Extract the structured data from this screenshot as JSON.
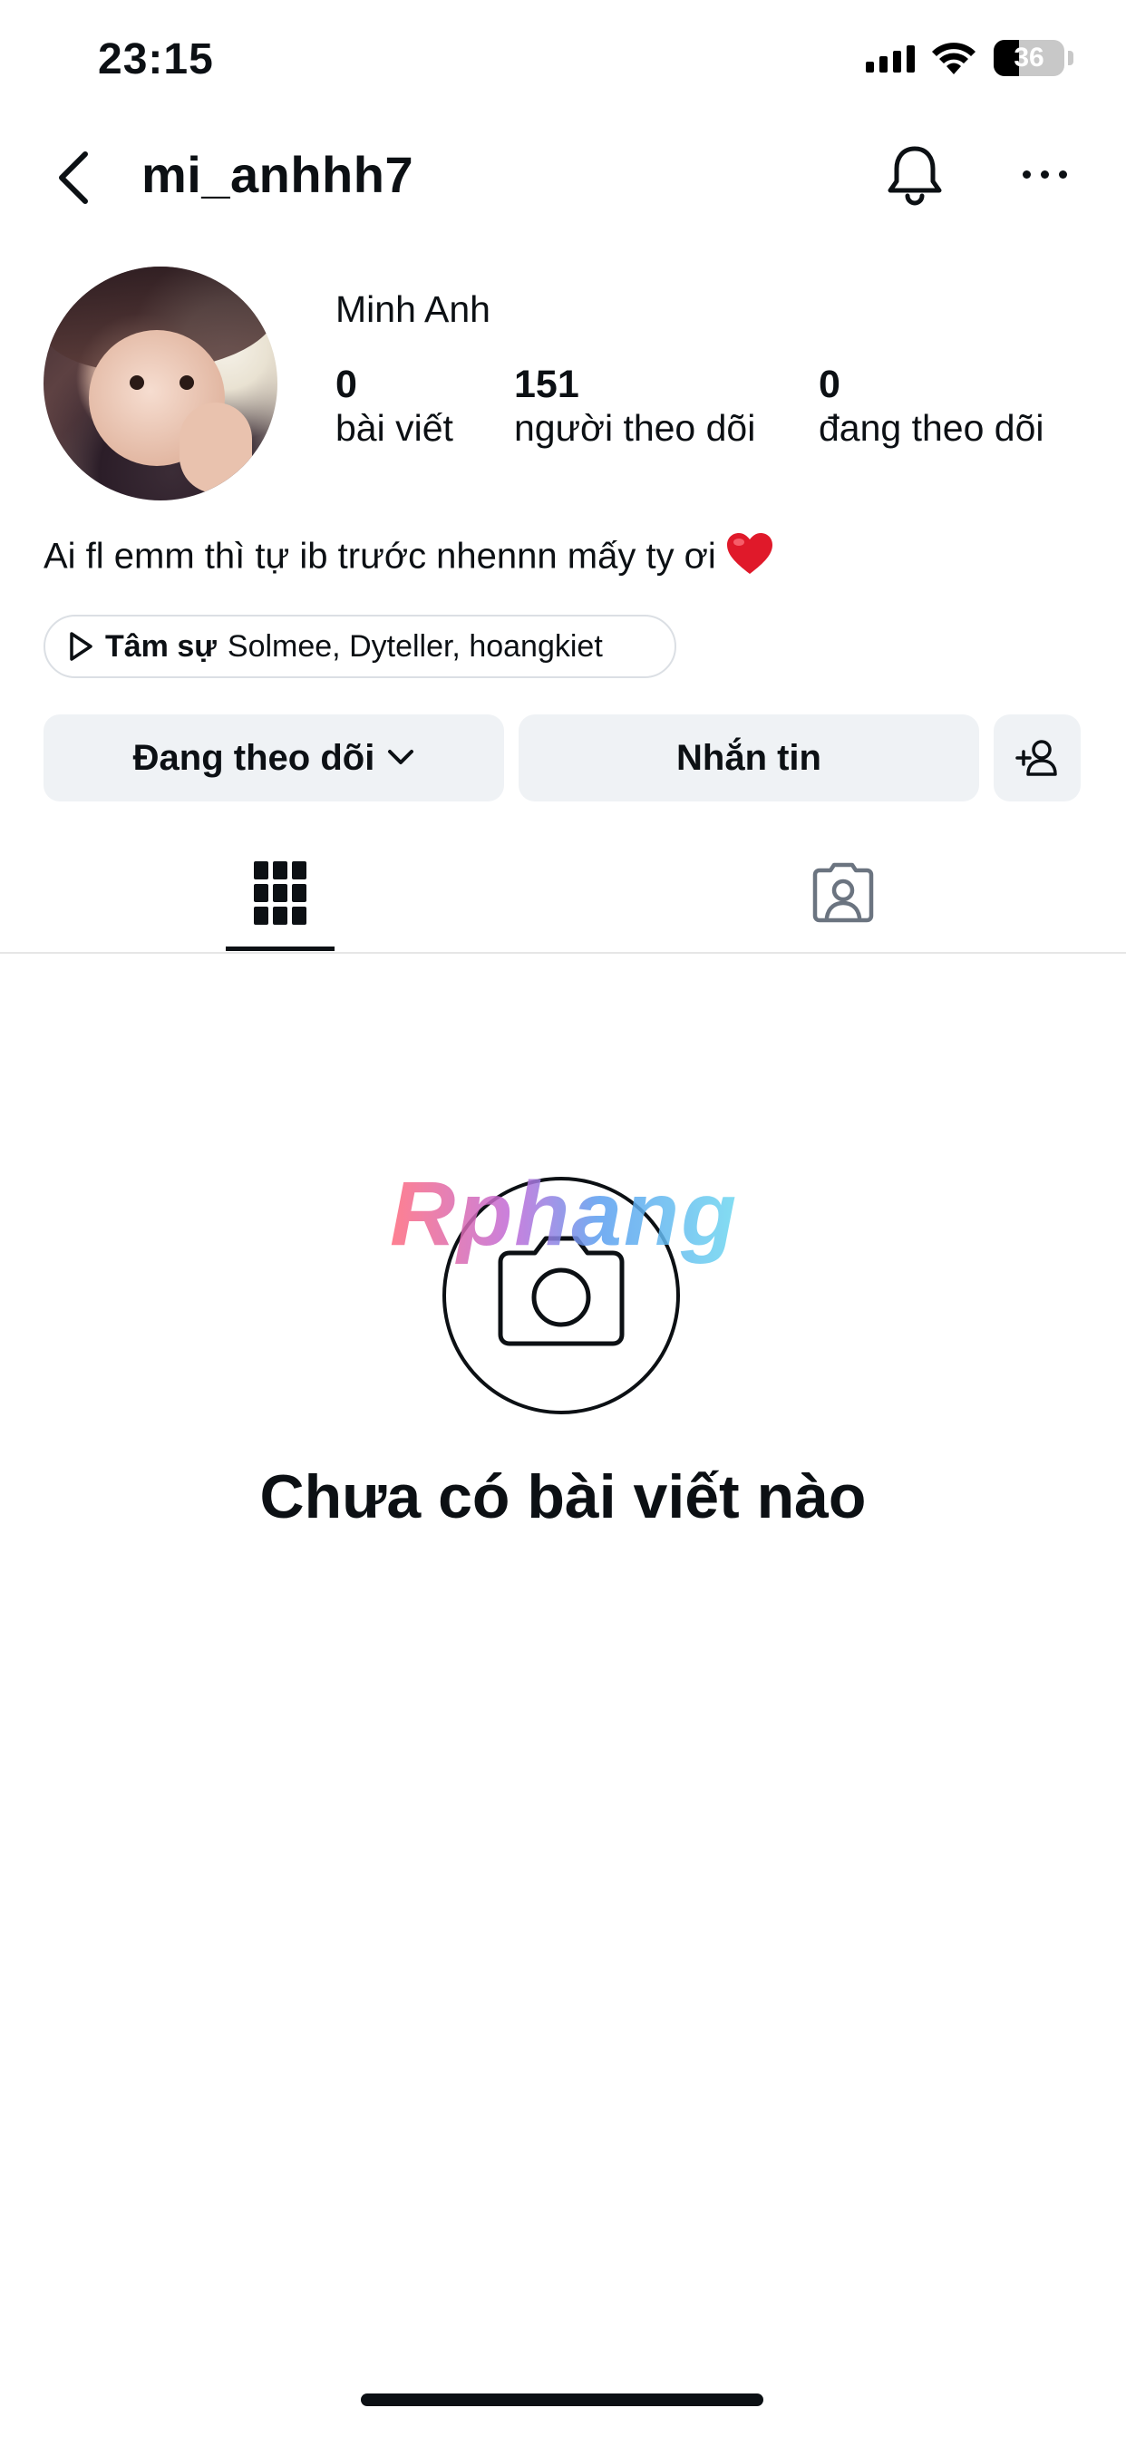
{
  "status_bar": {
    "time": "23:15",
    "battery_percent": "36",
    "battery_level": 0.36
  },
  "header": {
    "username": "mi_anhhh7"
  },
  "profile": {
    "full_name": "Minh Anh",
    "stats": [
      {
        "value": "0",
        "label": "bài viết"
      },
      {
        "value": "151",
        "label": "người theo dõi"
      },
      {
        "value": "0",
        "label": "đang theo dõi"
      }
    ],
    "bio": "Ai fl emm thì tự ib trước nhennn mấy ty ơi",
    "music": {
      "title": "Tâm sự",
      "artists": "Solmee, Dyteller, hoangkiet"
    }
  },
  "actions": {
    "follow_label": "Đang theo dõi",
    "message_label": "Nhắn tin"
  },
  "tabs": [
    {
      "icon": "grid-icon",
      "active": true
    },
    {
      "icon": "tagged-icon",
      "active": false
    }
  ],
  "empty_state": {
    "title": "Chưa có bài viết nào",
    "watermark": "Rphang"
  },
  "colors": {
    "text": "#0c1014",
    "button_bg": "#eff2f5",
    "border": "#dbdfe4",
    "heart": "#e0192a"
  }
}
